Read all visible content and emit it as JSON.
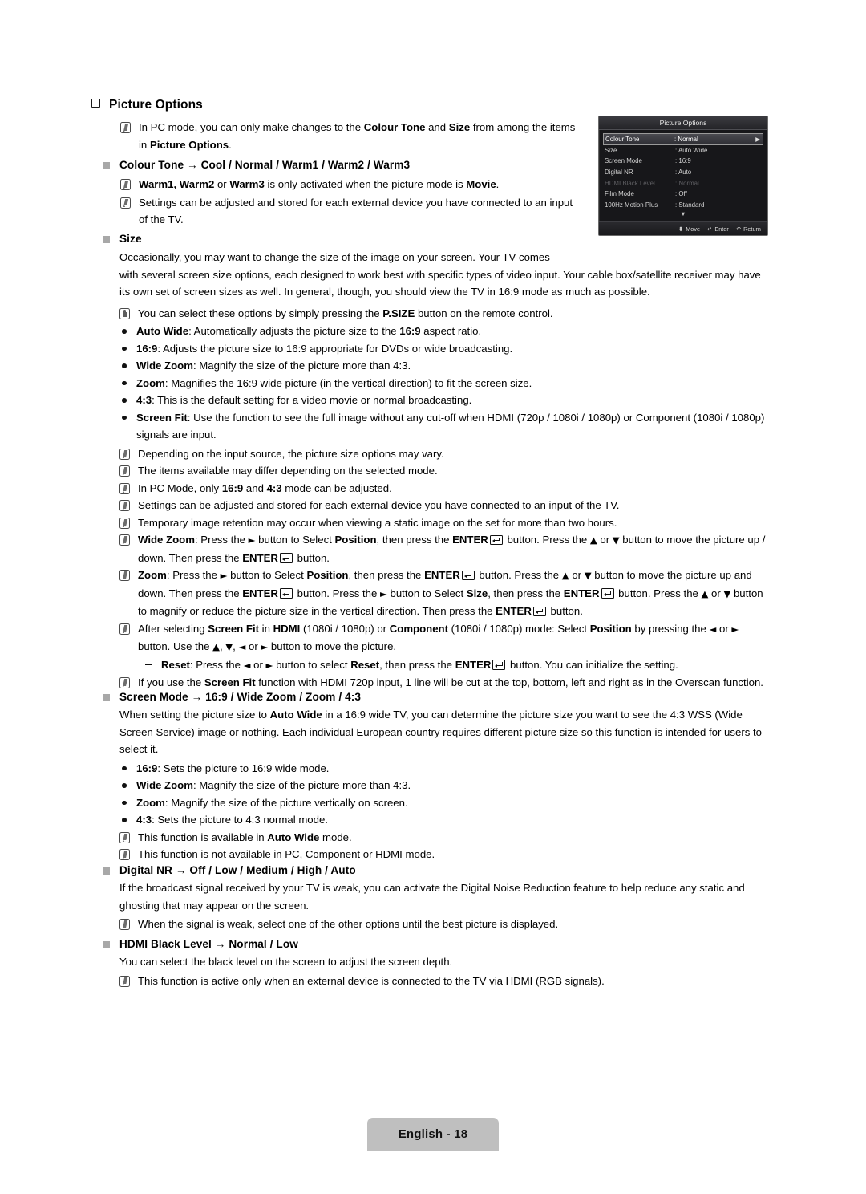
{
  "document": {
    "section_heading": "Picture Options",
    "footer": "English - 18"
  },
  "intro_note": {
    "text_1": "In PC mode, you can only make changes to the ",
    "bold_1": "Colour Tone",
    "text_2": " and ",
    "bold_2": "Size",
    "text_3": " from among the items in ",
    "bold_3": "Picture Options",
    "text_4": "."
  },
  "colour_tone": {
    "heading": "Colour Tone → Cool / Normal / Warm1 / Warm2 / Warm3",
    "notes": [
      "Warm1, Warm2 or Warm3 is only activated when the picture mode is Movie.",
      "Settings can be adjusted and stored for each external device you have connected to an input of the TV."
    ]
  },
  "size": {
    "heading": "Size",
    "paragraph": "Occasionally, you may want to change the size of the image on your screen. Your TV comes with several screen size options, each designed to work best with specific types of video input. Your cable box/satellite receiver may have its own set of screen sizes as well. In general, though, you should view the TV in 16:9 mode as much as possible.",
    "press_note": "You can select these options by simply pressing the P.SIZE button on the remote control.",
    "options": [
      {
        "term": "Auto Wide",
        "desc": ": Automatically adjusts the picture size to the 16:9 aspect ratio."
      },
      {
        "term": "16:9",
        "desc": ": Adjusts the picture size to 16:9 appropriate for DVDs or wide broadcasting."
      },
      {
        "term": "Wide Zoom",
        "desc": ": Magnify the size of the picture more than 4:3."
      },
      {
        "term": "Zoom",
        "desc": ": Magnifies the 16:9 wide picture (in the vertical direction) to fit the screen size."
      },
      {
        "term": "4:3",
        "desc": ": This is the default setting for a video movie or normal broadcasting."
      },
      {
        "term": "Screen Fit",
        "desc": ": Use the function to see the full image without any cut-off when HDMI (720p / 1080i / 1080p) or Component (1080i / 1080p) signals are input."
      }
    ],
    "notes": [
      "Depending on the input source, the picture size options may vary.",
      "The items available may differ depending on the selected mode.",
      "In PC Mode, only 16:9 and 4:3 mode can be adjusted.",
      "Settings can be adjusted and stored for each external device you have connected to an input of the TV.",
      "Temporary image retention may occur when viewing a static image on the set for more than two hours."
    ],
    "wide_zoom_note": "Wide Zoom: Press the ► button to Select Position, then press the ENTER button. Press the ▲ or ▼ button to move the picture up / down. Then press the ENTER button.",
    "zoom_note": "Zoom: Press the ► button to Select Position, then press the ENTER button. Press the ▲ or ▼ button to move the picture up and down. Then press the ENTER button. Press the ► button to Select Size, then press the ENTER button. Press the ▲ or ▼ button to magnify or reduce the picture size in the vertical direction. Then press the ENTER button.",
    "screen_fit_note": "After selecting Screen Fit in HDMI (1080i / 1080p) or Component (1080i / 1080p) mode: Select Position by pressing the ◄ or ► button. Use the ▲, ▼, ◄ or ► button to move the picture.",
    "reset_note": "Reset: Press the ◄ or ► button to select Reset, then press the ENTER button. You can initialize the setting.",
    "overscan_note": "If you use the Screen Fit function with HDMI 720p input, 1 line will be cut at the top, bottom, left and right as in the Overscan function."
  },
  "screen_mode": {
    "heading": "Screen Mode → 16:9 / Wide Zoom / Zoom / 4:3",
    "paragraph": "When setting the picture size to Auto Wide in a 16:9 wide TV, you can determine the picture size you want to see the 4:3 WSS (Wide Screen Service) image or nothing. Each individual European country requires different picture size so this function is intended for users to select it.",
    "options": [
      {
        "term": "16:9",
        "desc": ": Sets the picture to 16:9 wide mode."
      },
      {
        "term": "Wide Zoom",
        "desc": ": Magnify the size of the picture more than 4:3."
      },
      {
        "term": "Zoom",
        "desc": ": Magnify the size of the picture vertically on screen."
      },
      {
        "term": "4:3",
        "desc": ": Sets the picture to 4:3 normal mode."
      }
    ],
    "notes": [
      "This function is available in Auto Wide mode.",
      "This function is not available in PC, Component or HDMI mode."
    ]
  },
  "digital_nr": {
    "heading": "Digital NR → Off / Low / Medium / High / Auto",
    "paragraph": "If the broadcast signal received by your TV is weak, you can activate the Digital Noise Reduction feature to help reduce any static and ghosting that may appear on the screen.",
    "note": "When the signal is weak, select one of the other options until the best picture is displayed."
  },
  "hdmi_black_level": {
    "heading": "HDMI Black Level → Normal / Low",
    "paragraph": "You can select the black level on the screen to adjust the screen depth.",
    "note": "This function is active only when an external device is connected to the TV via HDMI (RGB signals)."
  },
  "tv_menu": {
    "title": "Picture Options",
    "rows": [
      {
        "label": "Colour Tone",
        "value": ": Normal",
        "selected": true,
        "dimmed": false
      },
      {
        "label": "Size",
        "value": ": Auto Wide",
        "selected": false,
        "dimmed": false
      },
      {
        "label": "Screen Mode",
        "value": ": 16:9",
        "selected": false,
        "dimmed": false
      },
      {
        "label": "Digital NR",
        "value": ": Auto",
        "selected": false,
        "dimmed": false
      },
      {
        "label": "HDMI Black Level",
        "value": ": Normal",
        "selected": false,
        "dimmed": true
      },
      {
        "label": "Film Mode",
        "value": ": Off",
        "selected": false,
        "dimmed": false
      },
      {
        "label": "100Hz Motion Plus",
        "value": ": Standard",
        "selected": false,
        "dimmed": false
      }
    ],
    "scroll_glyph": "▼",
    "footer": {
      "move": "Move",
      "enter": "Enter",
      "return": "Return"
    }
  },
  "colors": {
    "menu_background": "#17171a",
    "menu_title_bar": "#3b3b40",
    "selected_row": "#4a4a50",
    "page_tag": "#bfbfbf",
    "bullet_square": "#a8a8a8"
  }
}
